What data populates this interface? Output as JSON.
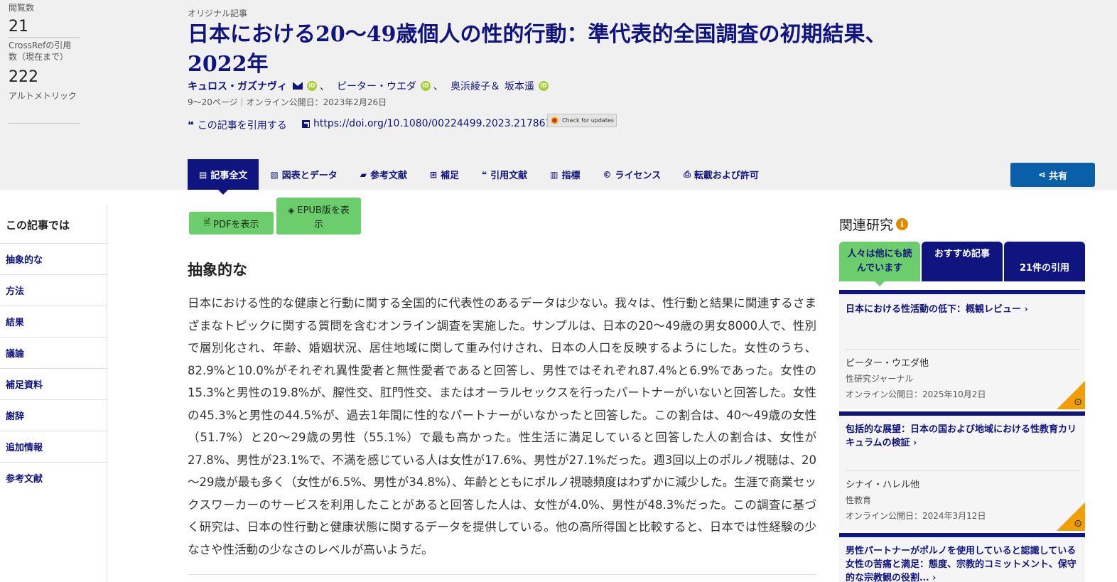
{
  "metrics": {
    "views_label": "閲覧数",
    "views_value": "21",
    "crossref_label": "CrossRefの引用数（現在まで）",
    "crossref_value": "222",
    "altmetric_label": "アルトメトリック"
  },
  "article": {
    "type": "オリジナル記事",
    "title": "日本における20～49歳個人の性的行動：準代表的全国調査の初期結果、2022年",
    "authors": [
      {
        "name": "キュロス・ガズナヴィ",
        "corresponding": true,
        "orcid": true,
        "sep": "、"
      },
      {
        "name": "ピーター・ウエダ",
        "corresponding": false,
        "orcid": true,
        "sep": "、"
      },
      {
        "name": "奥浜綾子＆",
        "corresponding": false,
        "orcid": false,
        "sep": ""
      },
      {
        "name": "坂本遥",
        "corresponding": false,
        "orcid": true,
        "sep": ""
      }
    ],
    "orcid_badge": "iD",
    "pub_line": "9～20ページ｜オンライン公開日：2023年2月26日",
    "cite_label": "この記事を引用する",
    "doi": "https://doi.org/10.1080/00224499.2023.2178614",
    "check_updates": "Check for updates"
  },
  "tabs": [
    {
      "label": "記事全文",
      "icon": "▤",
      "icon_name": "document-icon",
      "active": true
    },
    {
      "label": "図表とデータ",
      "icon": "▨",
      "icon_name": "image-icon",
      "active": false
    },
    {
      "label": "参考文献",
      "icon": "▰",
      "icon_name": "book-icon",
      "active": false
    },
    {
      "label": "補足",
      "icon": "⊞",
      "icon_name": "plus-square-icon",
      "active": false
    },
    {
      "label": "引用文献",
      "icon": "❝",
      "icon_name": "quote-icon",
      "active": false
    },
    {
      "label": "指標",
      "icon": "▥",
      "icon_name": "bar-chart-icon",
      "active": false
    },
    {
      "label": "ライセンス",
      "icon": "©",
      "icon_name": "copyright-icon",
      "active": false
    },
    {
      "label": "転載および許可",
      "icon": "⎙",
      "icon_name": "print-icon",
      "active": false
    }
  ],
  "share_label": "共有",
  "left_nav": {
    "heading": "この記事では",
    "items": [
      "抽象的な",
      "方法",
      "結果",
      "議論",
      "補足資料",
      "謝辞",
      "追加情報",
      "参考文献"
    ]
  },
  "buttons": {
    "pdf": "PDFを表示",
    "epub": "EPUB版を表示"
  },
  "abstract": {
    "heading": "抽象的な",
    "text": "日本における性的な健康と行動に関する全国的に代表性のあるデータは少ない。我々は、性行動と結果に関連するさまざまなトピックに関する質問を含むオンライン調査を実施した。サンプルは、日本の20～49歳の男女8000人で、性別で層別化され、年齢、婚姻状況、居住地域に関して重み付けされ、日本の人口を反映するようにした。女性のうち、82.9%と10.0%がそれぞれ異性愛者と無性愛者であると回答し、男性ではそれぞれ87.4%と6.9%であった。女性の15.3%と男性の19.8%が、膣性交、肛門性交、またはオーラルセックスを行ったパートナーがいないと回答した。女性の45.3%と男性の44.5%が、過去1年間に性的なパートナーがいなかったと回答した。この割合は、40～49歳の女性（51.7%）と20～29歳の男性（55.1%）で最も高かった。性生活に満足していると回答した人の割合は、女性が27.8%、男性が23.1%で、不満を感じている人は女性が17.6%、男性が27.1%だった。週3回以上のポルノ視聴は、20～29歳が最も多く（女性が6.5%、男性が34.8%）、年齢とともにポルノ視聴頻度はわずかに減少した。生涯で商業セックスワーカーのサービスを利用したことがあると回答した人は、女性が4.0%、男性が48.3%だった。この調査に基づく研究は、日本の性行動と健康状態に関するデータを提供している。他の高所得国と比較すると、日本では性経験の少なさや性活動の少なさのレベルが高いようだ。"
  },
  "related": {
    "heading": "関連研究",
    "info_icon": "i",
    "tabs": [
      "人々は他にも読んでいます",
      "おすすめ記事",
      "21件の引用"
    ],
    "cards": [
      {
        "title": "日本における性活動の低下：概観レビュー",
        "author": "ピーター・ウエダ他",
        "journal": "性研究ジャーナル",
        "date": "オンライン公開日：2025年10月2日"
      },
      {
        "title": "包括的な展望：日本の国および地域における性教育カリキュラムの検証",
        "author": "シナイ・ハレル他",
        "journal": "性教育",
        "date": "オンライン公開日：2024年3月12日"
      },
      {
        "title": "男性パートナーがポルノを使用していると認識している女性の苦痛と満足：態度、宗教的コミットメント、保守的な宗教観の役割..."
      }
    ]
  }
}
